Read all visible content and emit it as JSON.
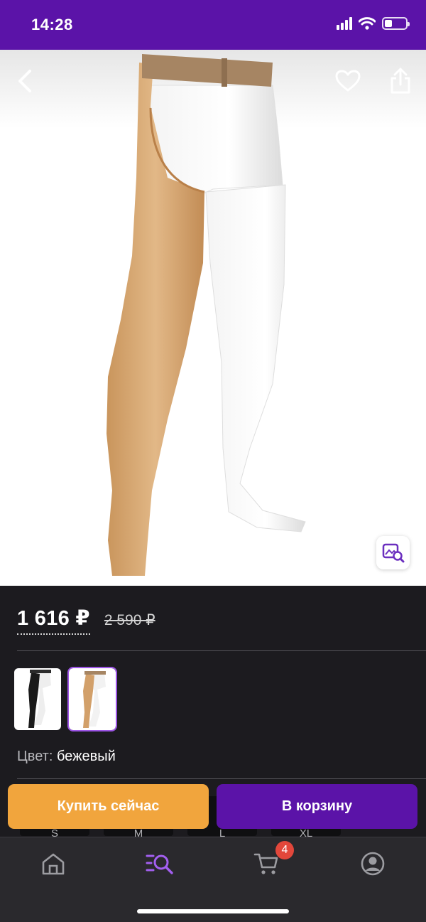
{
  "status_bar": {
    "time": "14:28",
    "battery_level": 0.35
  },
  "header": {
    "back_icon": "chevron-left-icon",
    "favorite_icon": "heart-icon",
    "share_icon": "share-icon",
    "visual_search_icon": "image-search-icon"
  },
  "product": {
    "price": "1 616 ₽",
    "old_price": "2 590 ₽",
    "color_label": "Цвет:",
    "color_value": "бежевый",
    "variants": [
      {
        "color": "black",
        "selected": false
      },
      {
        "color": "beige",
        "selected": true
      }
    ],
    "sizes": [
      "S",
      "M",
      "L",
      "XL"
    ]
  },
  "actions": {
    "buy_now": "Купить сейчас",
    "add_to_cart": "В корзину"
  },
  "tabbar": {
    "items": [
      {
        "icon": "home-icon",
        "active": false
      },
      {
        "icon": "catalog-search-icon",
        "active": true
      },
      {
        "icon": "cart-icon",
        "active": false
      },
      {
        "icon": "profile-icon",
        "active": false
      }
    ],
    "cart_badge": "4"
  },
  "colors": {
    "brand_purple": "#5b13a8",
    "accent_orange": "#f1a53d",
    "badge_red": "#e2473b",
    "active_tab": "#a35ff0"
  }
}
